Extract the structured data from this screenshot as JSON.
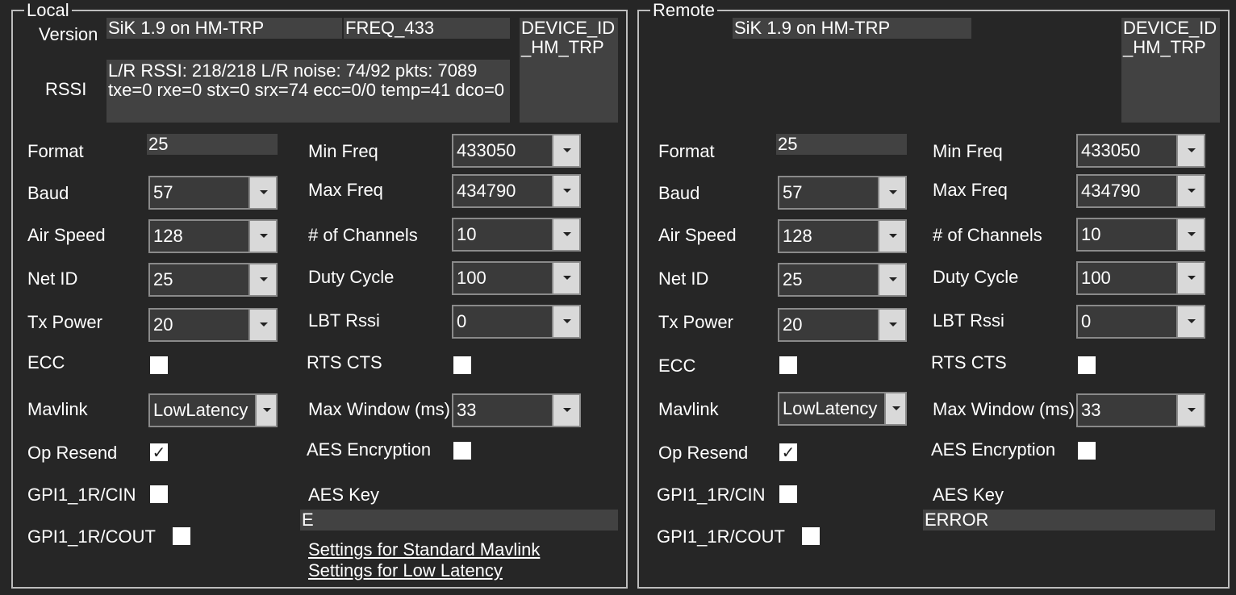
{
  "local": {
    "legend": "Local",
    "version_label": "Version",
    "version": "SiK 1.9 on HM-TRP",
    "freq": "FREQ_433",
    "device_id": "DEVICE_ID\n_HM_TRP",
    "rssi_label": "RSSI",
    "rssi_text": "L/R RSSI: 218/218  L/R noise: 74/92 pkts: 7089\ntxe=0 rxe=0 stx=0 srx=74 ecc=0/0 temp=41 dco=0",
    "format_label": "Format",
    "format": "25",
    "baud_label": "Baud",
    "baud": "57",
    "airspeed_label": "Air Speed",
    "airspeed": "128",
    "netid_label": "Net ID",
    "netid": "25",
    "txpower_label": "Tx Power",
    "txpower": "20",
    "ecc_label": "ECC",
    "ecc": false,
    "mavlink_label": "Mavlink",
    "mavlink": "LowLatency",
    "opresend_label": "Op Resend",
    "opresend": true,
    "gpi_cin_label": "GPI1_1R/CIN",
    "gpi_cin": false,
    "gpi_cout_label": "GPI1_1R/COUT",
    "gpi_cout": false,
    "minfreq_label": "Min Freq",
    "minfreq": "433050",
    "maxfreq_label": "Max Freq",
    "maxfreq": "434790",
    "channels_label": "# of Channels",
    "channels": "10",
    "duty_label": "Duty Cycle",
    "duty": "100",
    "lbt_label": "LBT Rssi",
    "lbt": "0",
    "rtscts_label": "RTS CTS",
    "rtscts": false,
    "maxwin_label": "Max Window (ms)",
    "maxwin": "33",
    "aes_label": "AES Encryption",
    "aes": false,
    "aeskey_label": "AES Key",
    "aeskey": "E",
    "link_standard": "Settings for Standard Mavlink",
    "link_lowlatency": "Settings for Low Latency"
  },
  "remote": {
    "legend": "Remote",
    "version": "SiK 1.9 on HM-TRP",
    "device_id": "DEVICE_ID\n_HM_TRP",
    "format_label": "Format",
    "format": "25",
    "baud_label": "Baud",
    "baud": "57",
    "airspeed_label": "Air Speed",
    "airspeed": "128",
    "netid_label": "Net ID",
    "netid": "25",
    "txpower_label": "Tx Power",
    "txpower": "20",
    "ecc_label": "ECC",
    "ecc": false,
    "mavlink_label": "Mavlink",
    "mavlink": "LowLatency",
    "opresend_label": "Op Resend",
    "opresend": true,
    "gpi_cin_label": "GPI1_1R/CIN",
    "gpi_cin": false,
    "gpi_cout_label": "GPI1_1R/COUT",
    "gpi_cout": false,
    "minfreq_label": "Min Freq",
    "minfreq": "433050",
    "maxfreq_label": "Max Freq",
    "maxfreq": "434790",
    "channels_label": "# of Channels",
    "channels": "10",
    "duty_label": "Duty Cycle",
    "duty": "100",
    "lbt_label": "LBT Rssi",
    "lbt": "0",
    "rtscts_label": "RTS CTS",
    "rtscts": false,
    "maxwin_label": "Max Window (ms)",
    "maxwin": "33",
    "aes_label": "AES Encryption",
    "aes": false,
    "aeskey_label": "AES Key",
    "aeskey": "ERROR"
  },
  "colors": {
    "background": "#262626",
    "field": "#424242",
    "border": "#bdbdbd",
    "text": "#ffffff"
  }
}
